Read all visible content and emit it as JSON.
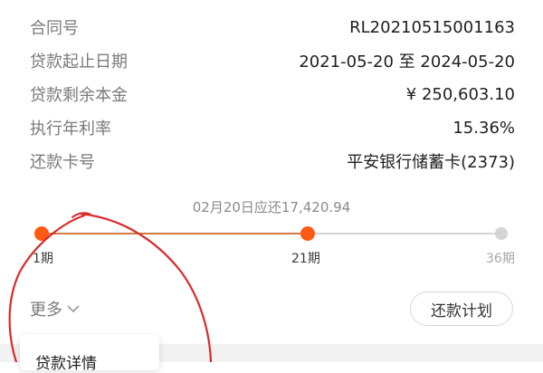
{
  "details": [
    {
      "label": "合同号",
      "value": "RL20210515001163"
    },
    {
      "label": "贷款起止日期",
      "value": "2021-05-20 至 2024-05-20"
    },
    {
      "label": "贷款剩余本金",
      "value": "¥ 250,603.10"
    },
    {
      "label": "执行年利率",
      "value": "15.36%"
    },
    {
      "label": "还款卡号",
      "value": "平安银行储蓄卡(2373)"
    }
  ],
  "progress": {
    "due_note": "02月20日应还17,420.94",
    "start_label": "1期",
    "current_label": "21期",
    "end_label": "36期",
    "current_period": 21,
    "total_periods": 36
  },
  "actions": {
    "more_label": "更多",
    "plan_button": "还款计划"
  },
  "menu": {
    "item_label": "贷款详情"
  },
  "colors": {
    "accent": "#ff5a13",
    "track_done": "#d07a45",
    "track_todo": "#d6d6d6",
    "annotation": "#d92b2b"
  },
  "icons": {
    "more": "chevron-down-icon"
  }
}
